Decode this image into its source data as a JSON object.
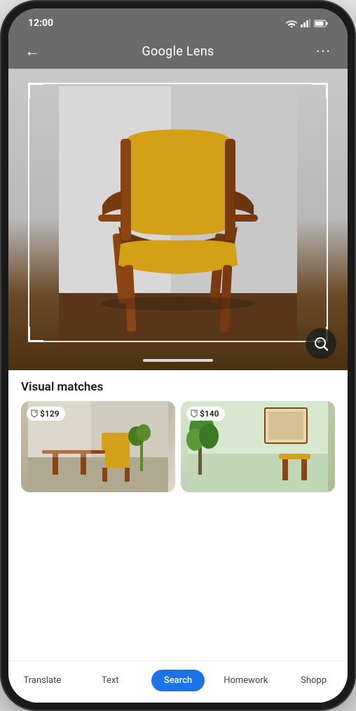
{
  "status_bar": {
    "time": "12:00",
    "signal": true,
    "wifi": true,
    "battery": true
  },
  "top_bar": {
    "back_label": "←",
    "title": "Google Lens",
    "more_label": "···"
  },
  "image": {
    "alt": "Yellow mid-century modern chair with wooden frame"
  },
  "lens_button": {
    "label": "lens"
  },
  "results": {
    "section_title": "Visual matches",
    "matches": [
      {
        "price": "$129",
        "alt": "Yellow chair in living room"
      },
      {
        "price": "$140",
        "alt": "Yellow chair near plant and artwork"
      }
    ]
  },
  "tabs": [
    {
      "label": "Translate",
      "active": false
    },
    {
      "label": "Text",
      "active": false
    },
    {
      "label": "Search",
      "active": true
    },
    {
      "label": "Homework",
      "active": false
    },
    {
      "label": "Shopp",
      "active": false
    }
  ],
  "colors": {
    "active_tab": "#1a73e8",
    "inactive_tab": "#444444",
    "header_bg": "#6b6b6b"
  }
}
